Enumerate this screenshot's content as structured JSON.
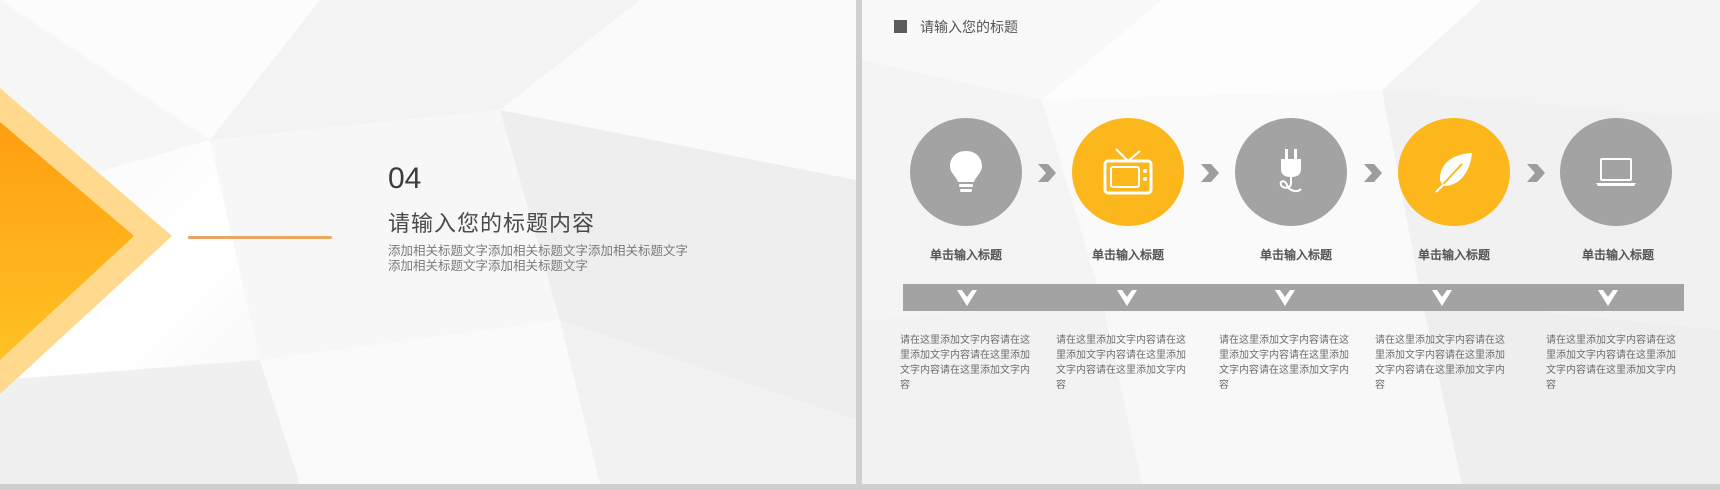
{
  "left_slide": {
    "number": "04",
    "title": "请输入您的标题内容",
    "subtitle": "添加相关标题文字添加相关标题文字添加相关标题文字添加相关标题文字添加相关标题文字"
  },
  "right_slide": {
    "header_title": "请输入您的标题",
    "steps": [
      {
        "label": "单击输入标题",
        "icon": "lightbulb-icon",
        "color": "#a3a3a3",
        "description": "请在这里添加文字内容请在这里添加文字内容请在这里添加文字内容请在这里添加文字内容"
      },
      {
        "label": "单击输入标题",
        "icon": "tv-icon",
        "color": "#fbb71b",
        "description": "请在这里添加文字内容请在这里添加文字内容请在这里添加文字内容请在这里添加文字内容"
      },
      {
        "label": "单击输入标题",
        "icon": "plug-icon",
        "color": "#a3a3a3",
        "description": "请在这里添加文字内容请在这里添加文字内容请在这里添加文字内容请在这里添加文字内容"
      },
      {
        "label": "单击输入标题",
        "icon": "leaf-icon",
        "color": "#fbb71b",
        "description": "请在这里添加文字内容请在这里添加文字内容请在这里添加文字内容请在这里添加文字内容"
      },
      {
        "label": "单击输入标题",
        "icon": "laptop-icon",
        "color": "#a3a3a3",
        "description": "请在这里添加文字内容请在这里添加文字内容请在这里添加文字内容请在这里添加文字内容"
      }
    ]
  },
  "colors": {
    "accent_orange": "#f7a21b",
    "accent_yellow": "#fbb71b",
    "neutral_gray": "#a3a3a3"
  }
}
